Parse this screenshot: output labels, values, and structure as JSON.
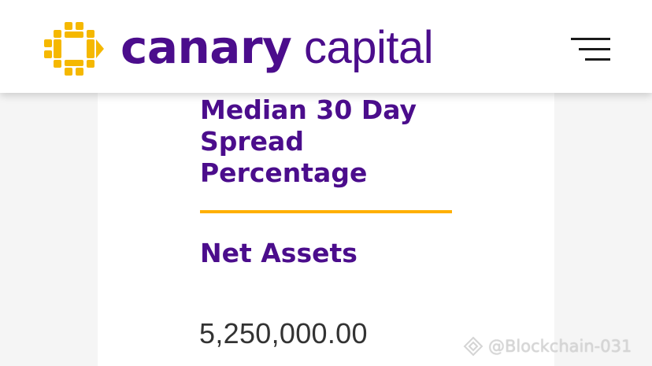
{
  "header": {
    "brand_bold": "canary",
    "brand_light": " capital",
    "logo_icon": "canary-capital-logo-icon",
    "menu_icon": "hamburger-menu-icon"
  },
  "content": {
    "spread_heading": "Median 30 Day Spread Percentage",
    "net_assets_heading": "Net Assets",
    "net_assets_value": "5,250,000.00"
  },
  "watermark": {
    "text": "@Blockchain-031",
    "icon": "binance-diamond-icon"
  },
  "colors": {
    "brand_purple": "#4b0d8c",
    "accent_gold": "#ffb000",
    "logo_yellow": "#f5b800",
    "header_bg": "#ffffff",
    "page_bg": "#f5f5f5"
  }
}
